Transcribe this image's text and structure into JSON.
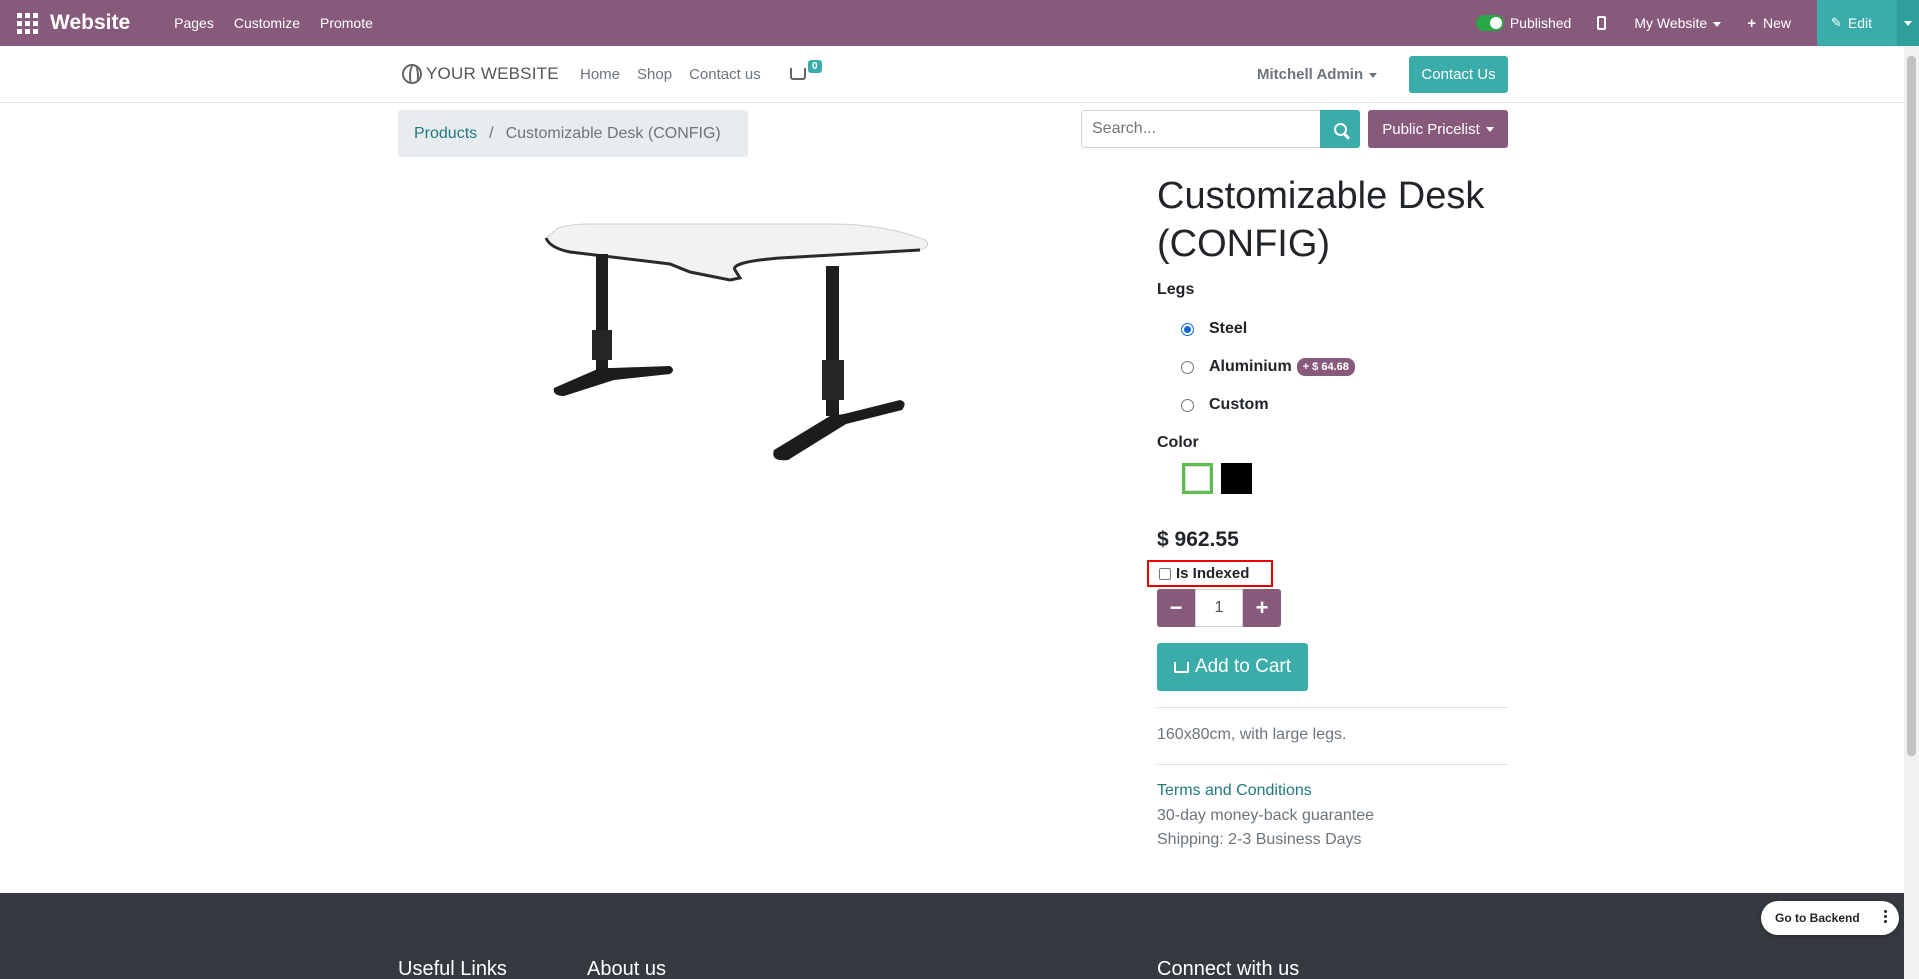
{
  "editor_bar": {
    "brand": "Website",
    "menu": [
      "Pages",
      "Customize",
      "Promote"
    ],
    "published_label": "Published",
    "website_label": "My Website",
    "new_label": "New",
    "edit_label": "Edit"
  },
  "header": {
    "logo_text": "YOUR WEBSITE",
    "nav": [
      "Home",
      "Shop",
      "Contact us"
    ],
    "cart_count": "0",
    "user": "Mitchell Admin",
    "contact_button": "Contact Us"
  },
  "breadcrumb": {
    "parent": "Products",
    "separator": "/",
    "current": "Customizable Desk (CONFIG)"
  },
  "search": {
    "placeholder": "Search...",
    "pricelist": "Public Pricelist"
  },
  "product": {
    "title": "Customizable Desk (CONFIG)",
    "legs_label": "Legs",
    "legs_options": [
      {
        "label": "Steel",
        "selected": true
      },
      {
        "label": "Aluminium",
        "extra": "+ $ 64.68",
        "selected": false
      },
      {
        "label": "Custom",
        "selected": false
      }
    ],
    "color_label": "Color",
    "colors": [
      "#ffffff",
      "#000000"
    ],
    "price": "$ 962.55",
    "is_indexed_label": "Is Indexed",
    "quantity": "1",
    "add_to_cart": "Add to Cart",
    "description": "160x80cm, with large legs.",
    "terms": "Terms and Conditions",
    "guarantee": "30-day money-back guarantee",
    "shipping": "Shipping: 2-3 Business Days"
  },
  "footer": {
    "useful_links": "Useful Links",
    "about_us": "About us",
    "connect": "Connect with us"
  },
  "floating": {
    "go_to_backend": "Go to Backend"
  },
  "colors": {
    "odoo_purple": "#875a7b",
    "teal": "#3aadaa",
    "footer_bg": "#343a40",
    "highlight_box": "#e60000"
  }
}
